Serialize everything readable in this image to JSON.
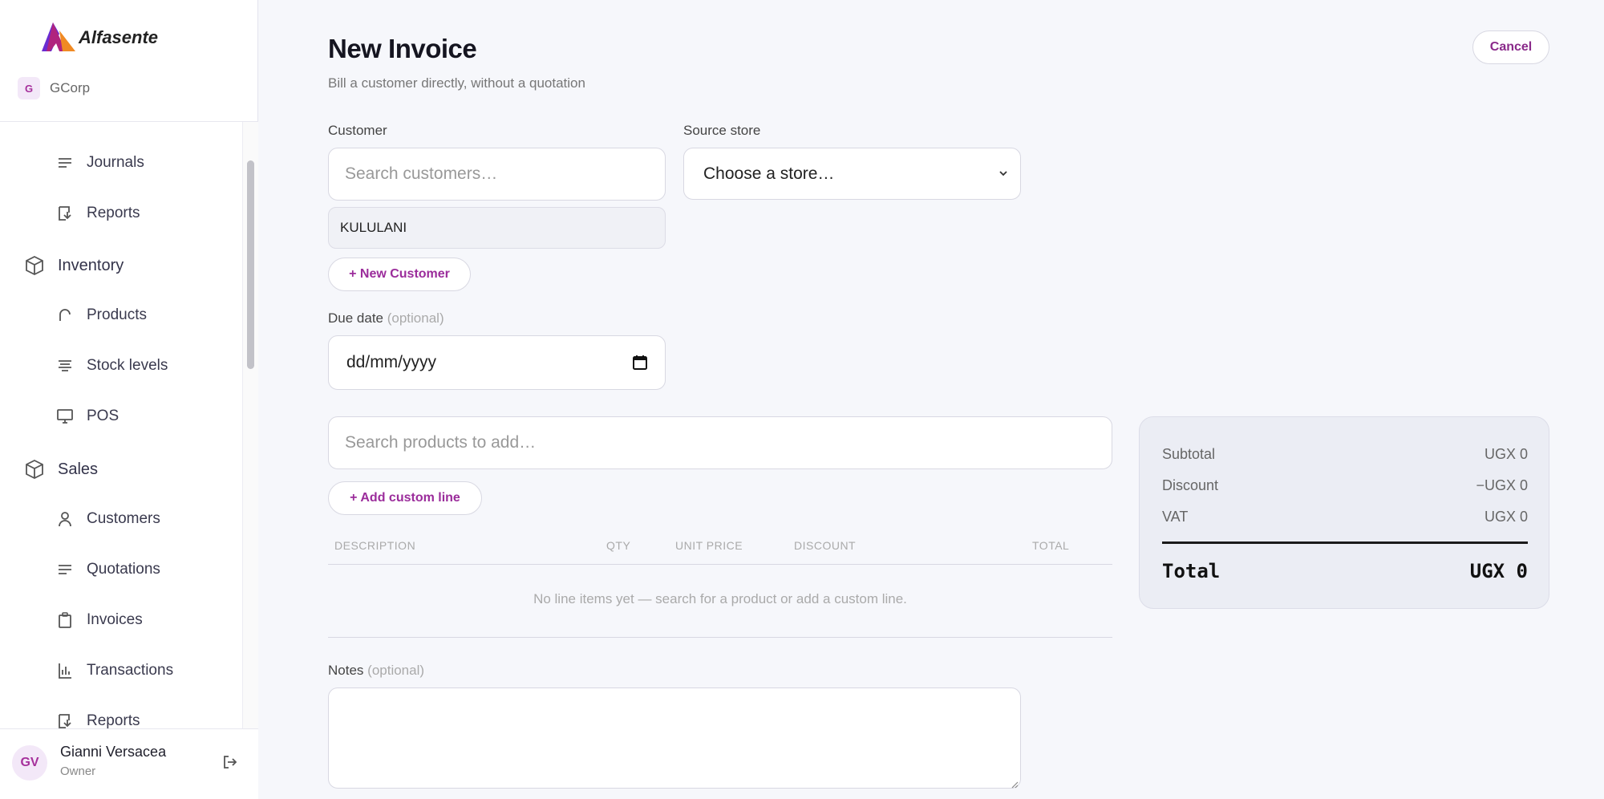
{
  "sidebar": {
    "brand": "Alfasente",
    "org": {
      "initial": "G",
      "name": "GCorp"
    },
    "nav": [
      {
        "label": "Journals",
        "icon": "lines-icon"
      },
      {
        "label": "Reports",
        "icon": "report-icon"
      },
      {
        "label": "Inventory",
        "icon": "box-icon"
      },
      {
        "label": "Products",
        "icon": "arch-icon"
      },
      {
        "label": "Stock levels",
        "icon": "stack-icon"
      },
      {
        "label": "POS",
        "icon": "monitor-icon"
      },
      {
        "label": "Sales",
        "icon": "box-icon"
      },
      {
        "label": "Customers",
        "icon": "user-icon"
      },
      {
        "label": "Quotations",
        "icon": "lines-icon"
      },
      {
        "label": "Invoices",
        "icon": "clipboard-icon"
      },
      {
        "label": "Transactions",
        "icon": "chart-icon"
      },
      {
        "label": "Reports",
        "icon": "report-icon"
      }
    ],
    "user": {
      "initials": "GV",
      "name": "Gianni Versacea",
      "role": "Owner"
    }
  },
  "header": {
    "title": "New Invoice",
    "subtitle": "Bill a customer directly, without a quotation",
    "cancel_label": "Cancel"
  },
  "form": {
    "customer_label": "Customer",
    "customer_placeholder": "Search customers…",
    "selected_customer": "KULULANI",
    "new_customer_label": "+ New Customer",
    "store_label": "Source store",
    "store_selected": "Choose a store…",
    "due_label": "Due date",
    "optional": "(optional)",
    "due_placeholder": "dd/mm/yyyy",
    "product_placeholder": "Search products to add…",
    "custom_line_label": "+ Add custom line",
    "notes_label": "Notes"
  },
  "table": {
    "columns": [
      "DESCRIPTION",
      "QTY",
      "UNIT PRICE",
      "DISCOUNT",
      "TOTAL"
    ],
    "empty": "No line items yet — search for a product or add a custom line."
  },
  "summary": {
    "subtotal_label": "Subtotal",
    "subtotal": "UGX 0",
    "discount_label": "Discount",
    "discount": "−UGX 0",
    "vat_label": "VAT",
    "vat": "UGX 0",
    "total_label": "Total",
    "total": "UGX 0"
  },
  "colors": {
    "accent": "#9b2c9b",
    "logo_orange": "#f08a24",
    "logo_purple": "#6a2bd1"
  }
}
